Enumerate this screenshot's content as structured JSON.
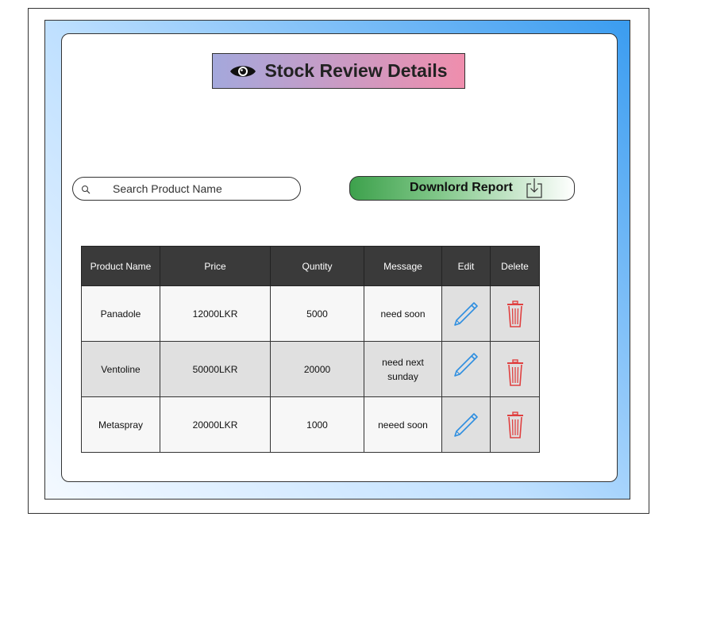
{
  "page": {
    "title": "Stock Review Details"
  },
  "icons": {
    "title_icon": "eye-icon",
    "search_icon": "search-icon",
    "download_icon": "download-icon",
    "edit_icon": "pencil-icon",
    "delete_icon": "trash-icon"
  },
  "search": {
    "placeholder": "Search Product Name",
    "value": ""
  },
  "download": {
    "label": "Downlord Report"
  },
  "table": {
    "headers": [
      "Product Name",
      "Price",
      "Quntity",
      "Message",
      "Edit",
      "Delete"
    ],
    "rows": [
      {
        "product": "Panadole",
        "price": "12000LKR",
        "quantity": "5000",
        "message": "need soon"
      },
      {
        "product": "Ventoline",
        "price": "50000LKR",
        "quantity": "20000",
        "message": "need next sunday"
      },
      {
        "product": "Metaspray",
        "price": "20000LKR",
        "quantity": "1000",
        "message": "neeed soon"
      }
    ]
  },
  "colors": {
    "edit_icon": "#2f8fe0",
    "delete_icon": "#e04040",
    "header_bg": "#3a3a3a"
  }
}
